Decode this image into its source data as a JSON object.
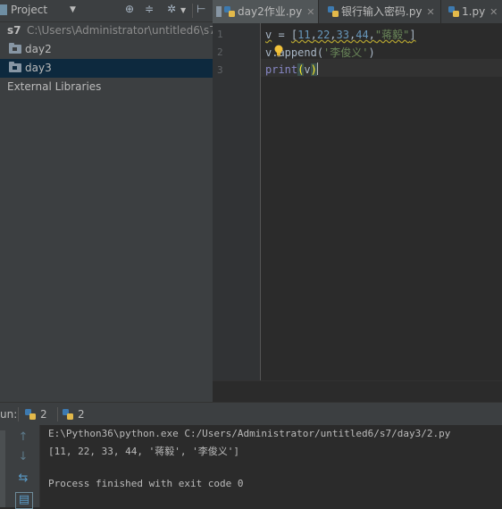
{
  "project_panel": {
    "title": "Project",
    "tree": {
      "root_name": "s7",
      "root_path": "C:\\Users\\Administrator\\untitled6\\s7",
      "folders": [
        {
          "label": "day2",
          "selected": false
        },
        {
          "label": "day3",
          "selected": true
        }
      ],
      "external": "External Libraries"
    }
  },
  "editor": {
    "tabs": [
      {
        "label": "day2作业.py",
        "active": false
      },
      {
        "label": "银行输入密码.py",
        "active": false
      },
      {
        "label": "1.py",
        "active": false
      }
    ],
    "line_numbers": [
      "1",
      "2",
      "3"
    ],
    "code": {
      "line1": {
        "var": "v",
        "eq": " = ",
        "open": "[",
        "n1": "11",
        "n2": "22",
        "n3": "33",
        "n4": "44",
        "comma": ",",
        "s": "\"蒋毅\"",
        "close": "]"
      },
      "line2": {
        "prefix": "v.",
        "method": "append",
        "open": "(",
        "s": "'李俊义'",
        "close": ")"
      },
      "line3": {
        "fn": "print",
        "open": "(",
        "arg": "v",
        "close": ")"
      }
    }
  },
  "run_panel": {
    "label": "un:",
    "tabs": [
      "2",
      "2"
    ],
    "console": [
      "E:\\Python36\\python.exe C:/Users/Administrator/untitled6/s7/day3/2.py",
      "[11, 22, 33, 44, '蒋毅', '李俊义']",
      "",
      "Process finished with exit code 0"
    ]
  },
  "colors": {
    "panel_bg": "#3c3f41",
    "editor_bg": "#2b2b2b",
    "selection": "#0d293e",
    "number": "#6897bb",
    "string": "#6a8759",
    "builtin": "#8888c6"
  }
}
